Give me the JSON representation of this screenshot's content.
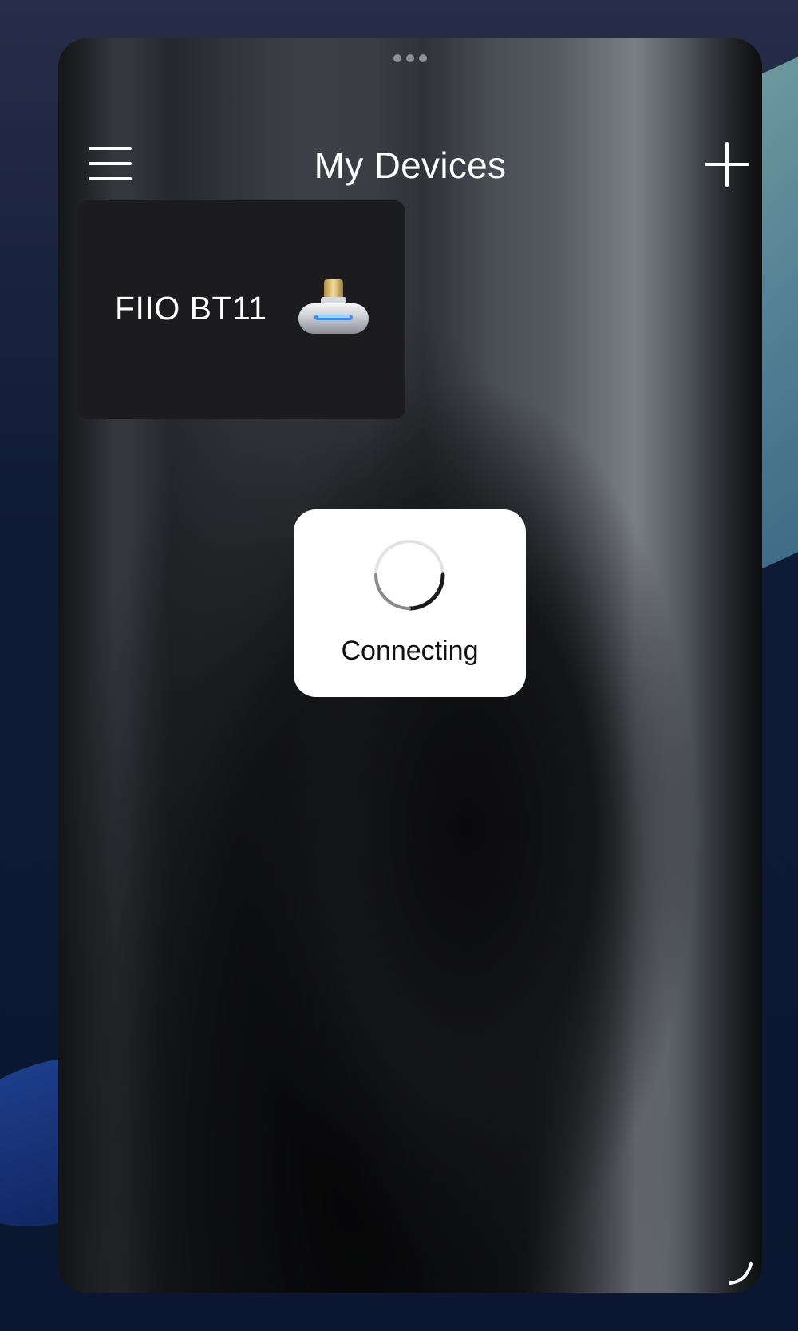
{
  "window": {
    "title": "My Devices"
  },
  "header": {
    "menu_icon": "hamburger-menu-icon",
    "add_icon": "plus-icon"
  },
  "devices": [
    {
      "name": "FIIO BT11",
      "icon": "usb-dongle-icon"
    }
  ],
  "loading": {
    "label": "Connecting",
    "icon": "spinner-icon"
  },
  "colors": {
    "card_background": "#1c1c1e",
    "hud_background": "#ffffff",
    "header_text": "#ffffff"
  }
}
